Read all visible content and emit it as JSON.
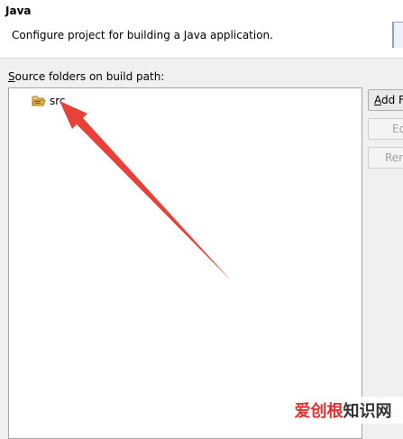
{
  "header": {
    "title": "Java",
    "description": "Configure project for building a Java application."
  },
  "source_folders": {
    "label_mnemonic": "S",
    "label_rest": "ource folders on build path:",
    "items": [
      {
        "label": "src",
        "icon": "source-folder-icon"
      }
    ]
  },
  "buttons": {
    "add_mnemonic": "A",
    "add_rest": "dd F",
    "edit": "Ed",
    "remove": "Ren"
  },
  "watermark": {
    "red": "爱创根",
    "dark": "知识网"
  },
  "colors": {
    "annotation_arrow": "#e8413a",
    "folder_icon": "#e3b14a"
  }
}
